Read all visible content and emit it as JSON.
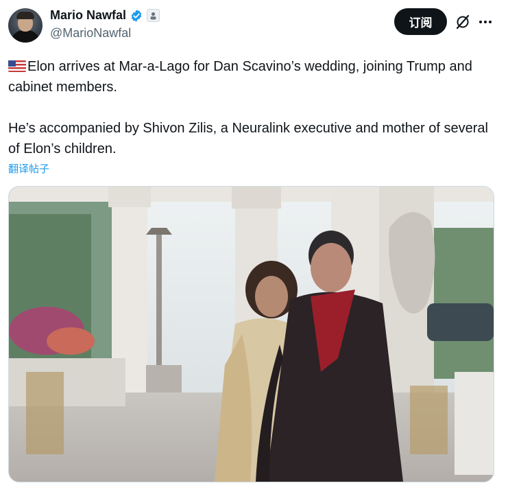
{
  "author": {
    "name": "Mario Nawfal",
    "handle": "@MarioNawfal",
    "verified_icon": "verified-badge-icon",
    "affiliation_icon": "affiliate-badge-icon"
  },
  "actions": {
    "subscribe_label": "订阅",
    "grok_icon": "grok-icon",
    "more_icon": "more-icon"
  },
  "tweet": {
    "flag_icon": "us-flag-icon",
    "line1": "Elon arrives at Mar-a-Lago for Dan Scavino’s wedding, joining Trump and cabinet members.",
    "line2": "He’s accompanied by Shivon Zilis, a Neuralink executive and mother of several of Elon’s children.",
    "translate_label": "翻译帖子"
  },
  "media": {
    "kind": "video"
  },
  "colors": {
    "text": "#0f1419",
    "secondary": "#536471",
    "link": "#1d9bf0",
    "verified": "#1d9bf0",
    "button_bg": "#0f1419"
  }
}
